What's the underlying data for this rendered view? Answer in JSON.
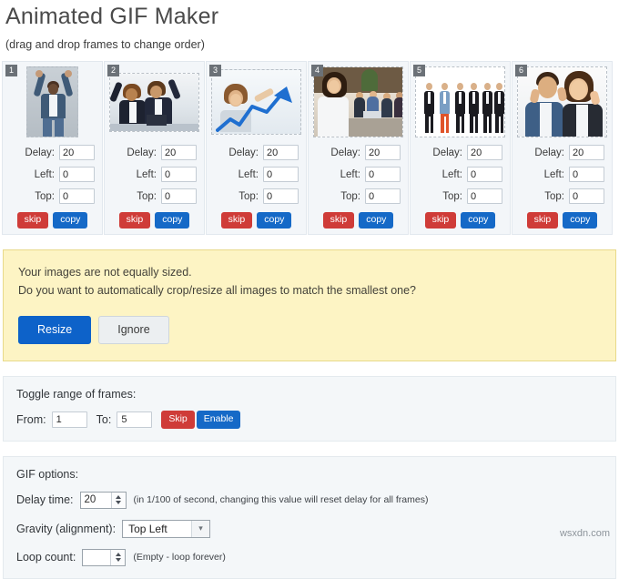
{
  "header": {
    "title": "Animated GIF Maker",
    "subtitle": "(drag and drop frames to change order)"
  },
  "frames": {
    "labels": {
      "delay": "Delay:",
      "left": "Left:",
      "top": "Top:"
    },
    "buttons": {
      "skip": "skip",
      "copy": "copy"
    },
    "items": [
      {
        "number": "1",
        "delay": "20",
        "left": "0",
        "top": "0",
        "alt": "man-arms-raised"
      },
      {
        "number": "2",
        "delay": "20",
        "left": "0",
        "top": "0",
        "alt": "two-women-celebrating"
      },
      {
        "number": "3",
        "delay": "20",
        "left": "0",
        "top": "0",
        "alt": "woman-drawing-growth-arrow"
      },
      {
        "number": "4",
        "delay": "20",
        "left": "0",
        "top": "0",
        "alt": "businesswoman-with-team"
      },
      {
        "number": "5",
        "delay": "20",
        "left": "0",
        "top": "0",
        "alt": "row-of-businessmen"
      },
      {
        "number": "6",
        "delay": "20",
        "left": "0",
        "top": "0",
        "alt": "couple-framing-faces"
      }
    ]
  },
  "warning": {
    "line1": "Your images are not equally sized.",
    "line2": "Do you want to automatically crop/resize all images to match the smallest one?",
    "resize_label": "Resize",
    "ignore_label": "Ignore",
    "background_color": "#fdf4c4",
    "primary_color": "#0d62c9"
  },
  "toggle_range": {
    "title": "Toggle range of frames:",
    "from_label": "From:",
    "from_value": "1",
    "to_label": "To:",
    "to_value": "5",
    "skip_label": "Skip",
    "enable_label": "Enable"
  },
  "gif_options": {
    "title": "GIF options:",
    "delay_label": "Delay time:",
    "delay_value": "20",
    "delay_hint": "(in 1/100 of second, changing this value will reset delay for all frames)",
    "gravity_label": "Gravity (alignment):",
    "gravity_value": "Top Left",
    "loop_label": "Loop count:",
    "loop_value": "",
    "loop_hint": "(Empty - loop forever)"
  },
  "watermark": "wsxdn.com",
  "colors": {
    "skip_red": "#cf3c38",
    "copy_blue": "#1569c7",
    "panel_bg": "#f4f7f9",
    "badge_gray": "#6b7177"
  }
}
